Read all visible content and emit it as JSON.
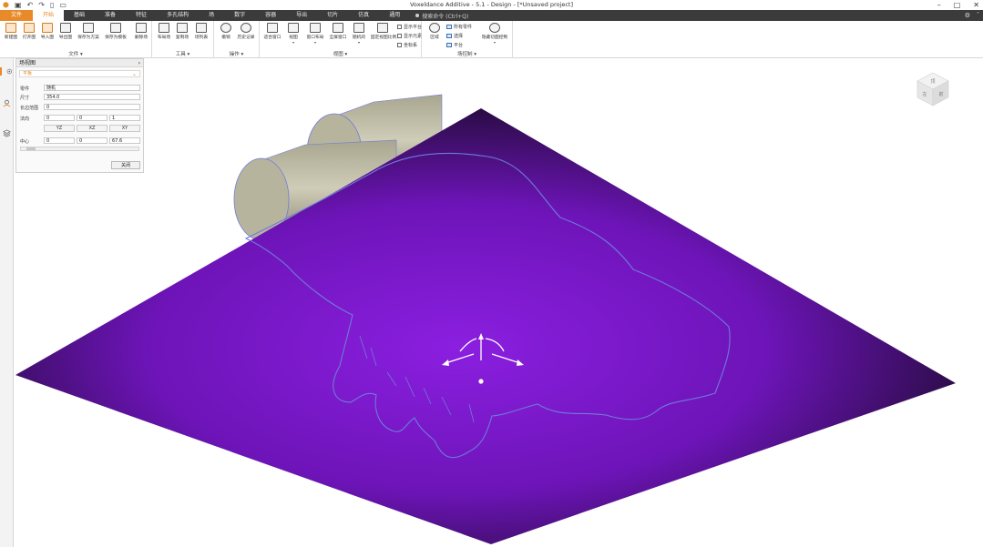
{
  "window": {
    "title": "Voxeldance Additive - 5.1 - Design - [*Unsaved project]",
    "qat_icons": [
      "logo-icon",
      "save-icon",
      "undo-icon",
      "redo-icon",
      "new-file-icon",
      "open-folder-icon"
    ],
    "controls": [
      "–",
      "□",
      "✕"
    ]
  },
  "tabs": {
    "file": "文件",
    "items": [
      "开始",
      "基础",
      "准备",
      "特征",
      "多孔结构",
      "场",
      "数字",
      "容器",
      "导出",
      "切片",
      "仿真",
      "通用"
    ],
    "active": "开始",
    "command_search": "搜索命令 (Ctrl+Q)"
  },
  "ribbon": {
    "groups": {
      "file": "文件",
      "tools": "工具",
      "operation": "操作",
      "view": "视图",
      "display": "场控制"
    },
    "buttons": {
      "new": "新建图",
      "open": "打开图",
      "import": "导入图",
      "export": "导出图",
      "save_as": "保存为方案",
      "save_template": "保存为模板",
      "delete": "删除场",
      "tool1": "布局场",
      "tool2": "复制场",
      "tool3": "场列表",
      "undo": "撤销",
      "history": "历史记录",
      "fit_view": "适合窗口",
      "view_mode": "视图",
      "window_layout": "窗口布局",
      "full_screen": "全屏窗口",
      "edge": "随机的",
      "hide_others": "固定视图比例",
      "show_all": "所有零件",
      "select": "选择",
      "platform": "平台",
      "hidden_control": "隐藏切面控制"
    },
    "checkboxes": [
      "显示平台",
      "显示元素",
      "坐标系"
    ],
    "select_small": "区域"
  },
  "panel": {
    "title": "场视图",
    "subtitle": "平板",
    "rows": {
      "part_label": "零件",
      "part_value": "随机",
      "size_label": "尺寸",
      "size_value": "354.0",
      "offset_label": "长边范围",
      "offset_value": "0",
      "direction_label": "法向",
      "dir_x": "0",
      "dir_y": "0",
      "dir_z": "1",
      "center_label": "中心",
      "ctr_x": "0",
      "ctr_y": "0",
      "ctr_z": "67.6"
    },
    "plane_buttons": [
      "YZ",
      "XZ",
      "XY"
    ],
    "close": "关闭"
  },
  "viewcube": {
    "faces": [
      "前",
      "左",
      "顶"
    ]
  },
  "colors": {
    "accent": "#e98a2a",
    "tabbar": "#3b3b3b",
    "plane_center": "#8b1fe0",
    "plane_edge": "#1a0a2a",
    "contour": "#6f7bd8",
    "cylinder": "#b7b49e"
  }
}
